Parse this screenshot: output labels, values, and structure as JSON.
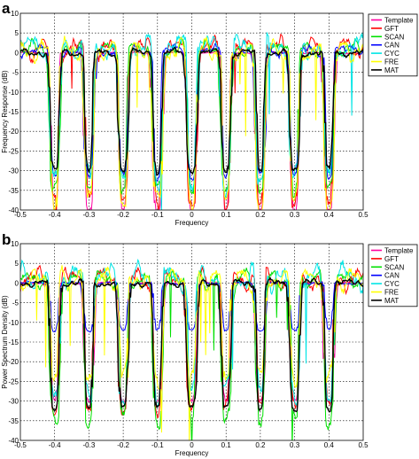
{
  "chart_data": [
    {
      "panel": "a",
      "type": "line",
      "xlabel": "Frequency",
      "ylabel": "Frequency Response (dB)",
      "xlim": [
        -0.5,
        0.5
      ],
      "ylim": [
        -40,
        10
      ],
      "xticks": [
        "-0.5",
        "-0.4",
        "-0.3",
        "-0.2",
        "-0.1",
        "0",
        "0.1",
        "0.2",
        "0.3",
        "0.4",
        "0.5"
      ],
      "yticks": [
        "10",
        "5",
        "0",
        "-5",
        "-10",
        "-15",
        "-20",
        "-25",
        "-30",
        "-35",
        "-40"
      ],
      "grid": true,
      "legend_position": "top-right",
      "notch_centers": [
        -0.4,
        -0.3,
        -0.2,
        -0.1,
        0.0,
        0.1,
        0.2,
        0.3,
        0.4
      ],
      "series": [
        {
          "name": "Template",
          "color": "#ff00a0",
          "notch_depth": -40,
          "ripple": 0.3,
          "base": 0.0
        },
        {
          "name": "GFT",
          "color": "#ff0000",
          "notch_depth": -38,
          "ripple": 3.0,
          "base": 1.0
        },
        {
          "name": "SCAN",
          "color": "#00e000",
          "notch_depth": -36,
          "ripple": 2.0,
          "base": 1.0
        },
        {
          "name": "CAN",
          "color": "#0000ff",
          "notch_depth": -32,
          "ripple": 1.5,
          "base": 0.5
        },
        {
          "name": "CYC",
          "color": "#00e5e5",
          "notch_depth": -34,
          "ripple": 3.5,
          "base": 1.5
        },
        {
          "name": "FRE",
          "color": "#ffff00",
          "notch_depth": -39,
          "ripple": 3.0,
          "base": 0.5
        },
        {
          "name": "MAT",
          "color": "#000000",
          "notch_depth": -30,
          "ripple": 1.0,
          "base": 0.0
        }
      ]
    },
    {
      "panel": "b",
      "type": "line",
      "xlabel": "Frequency",
      "ylabel": "Power Spectrum Density (dB)",
      "xlim": [
        -0.5,
        0.5
      ],
      "ylim": [
        -40,
        10
      ],
      "xticks": [
        "-0.5",
        "-0.4",
        "-0.3",
        "-0.2",
        "-0.1",
        "0",
        "0.1",
        "0.2",
        "0.3",
        "0.4",
        "0.5"
      ],
      "yticks": [
        "10",
        "5",
        "0",
        "-5",
        "-10",
        "-15",
        "-20",
        "-25",
        "-30",
        "-35",
        "-40"
      ],
      "grid": true,
      "legend_position": "top-right",
      "notch_centers": [
        -0.4,
        -0.3,
        -0.2,
        -0.1,
        0.0,
        0.1,
        0.2,
        0.3,
        0.4
      ],
      "series": [
        {
          "name": "Template",
          "color": "#ff00a0",
          "notch_depth": -30,
          "ripple": 0.3,
          "base": 0.0
        },
        {
          "name": "GFT",
          "color": "#ff0000",
          "notch_depth": -33,
          "ripple": 3.0,
          "base": 1.0
        },
        {
          "name": "SCAN",
          "color": "#00e000",
          "notch_depth": -36,
          "ripple": 2.5,
          "base": 1.0
        },
        {
          "name": "CAN",
          "color": "#0000ff",
          "notch_depth": -12,
          "ripple": 0.4,
          "base": 0.0
        },
        {
          "name": "CYC",
          "color": "#00e5e5",
          "notch_depth": -30,
          "ripple": 3.5,
          "base": 1.5
        },
        {
          "name": "FRE",
          "color": "#ffff00",
          "notch_depth": -25,
          "ripple": 3.0,
          "base": 1.0
        },
        {
          "name": "MAT",
          "color": "#000000",
          "notch_depth": -32,
          "ripple": 1.0,
          "base": 0.0
        }
      ]
    }
  ]
}
